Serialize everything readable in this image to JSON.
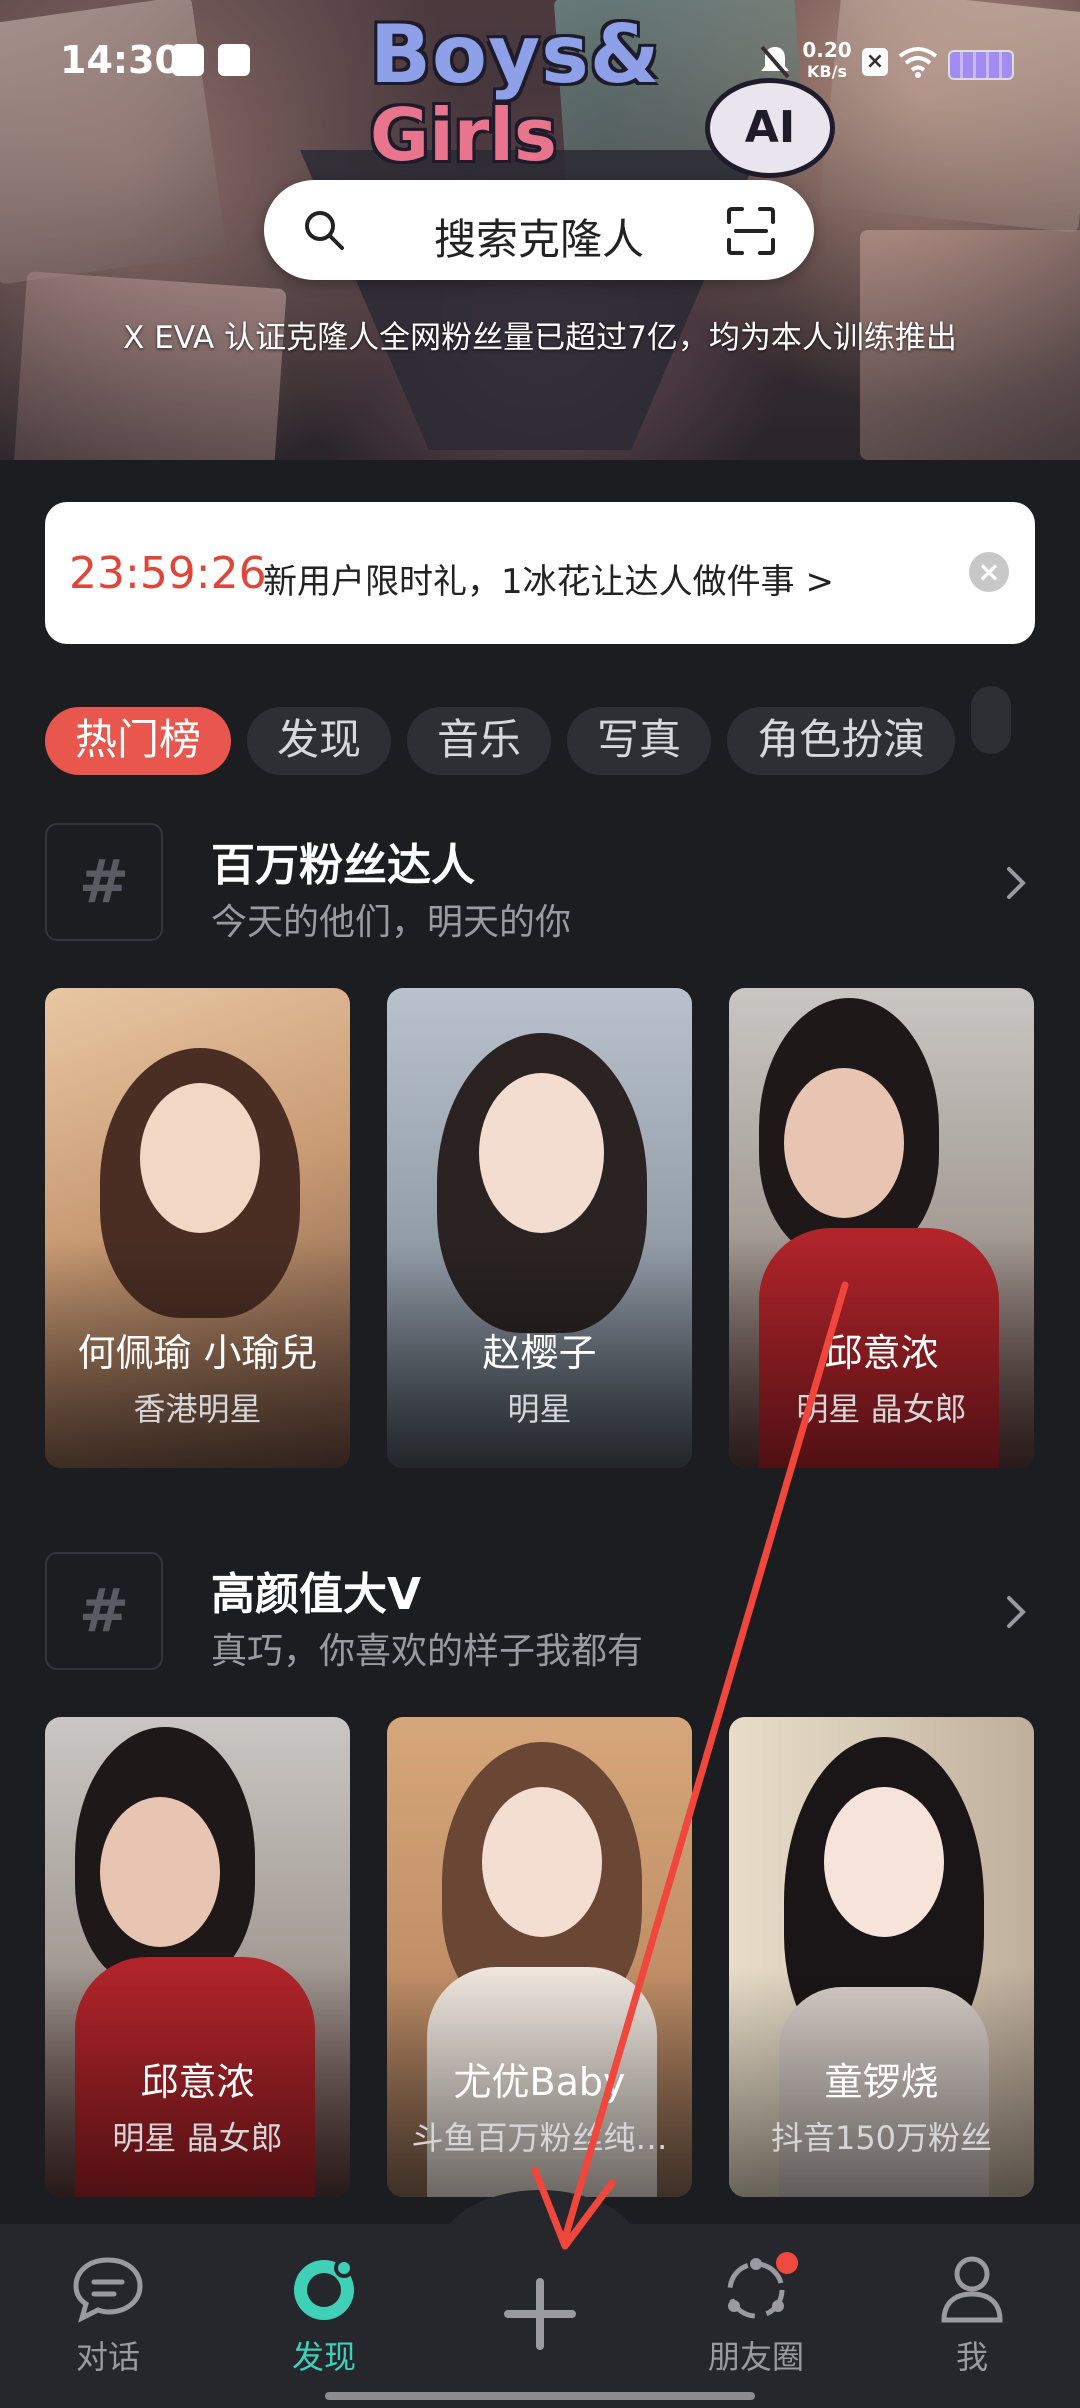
{
  "status_bar": {
    "time": "14:30",
    "net_speed_value": "0.20",
    "net_speed_unit": "KB/s"
  },
  "hero": {
    "logo_line1": "Boys&",
    "logo_line2": "Girls",
    "logo_badge": "AI",
    "search_placeholder": "搜索克隆人",
    "tagline": "X EVA 认证克隆人全网粉丝量已超过7亿，均为本人训练推出"
  },
  "promo": {
    "countdown": "23:59:26",
    "text": "新用户限时礼，1冰花让达人做件事 >"
  },
  "tabs": [
    "热门榜",
    "发现",
    "音乐",
    "写真",
    "角色扮演"
  ],
  "sections": [
    {
      "title": "百万粉丝达人",
      "subtitle": "今天的他们，明天的你",
      "cards": [
        {
          "name": "何佩瑜 小瑜兒",
          "tag": "香港明星"
        },
        {
          "name": "赵樱子",
          "tag": "明星"
        },
        {
          "name": "邱意浓",
          "tag": "明星 晶女郎"
        }
      ]
    },
    {
      "title": "高颜值大V",
      "subtitle": "真巧，你喜欢的样子我都有",
      "cards": [
        {
          "name": "邱意浓",
          "tag": "明星 晶女郎"
        },
        {
          "name": "尤优Baby",
          "tag": "斗鱼百万粉丝纯…"
        },
        {
          "name": "童锣烧",
          "tag": "抖音150万粉丝"
        }
      ]
    }
  ],
  "bottom_nav": [
    {
      "label": "对话",
      "icon": "chat-bubble-icon"
    },
    {
      "label": "发现",
      "icon": "discover-icon"
    },
    {
      "label": "",
      "icon": "plus-icon"
    },
    {
      "label": "朋友圈",
      "icon": "moments-icon"
    },
    {
      "label": "我",
      "icon": "profile-icon"
    }
  ],
  "colors": {
    "accent_red": "#e8564d",
    "accent_teal": "#3fd1b7",
    "countdown_red": "#e0453a",
    "background": "#1c1d21"
  }
}
